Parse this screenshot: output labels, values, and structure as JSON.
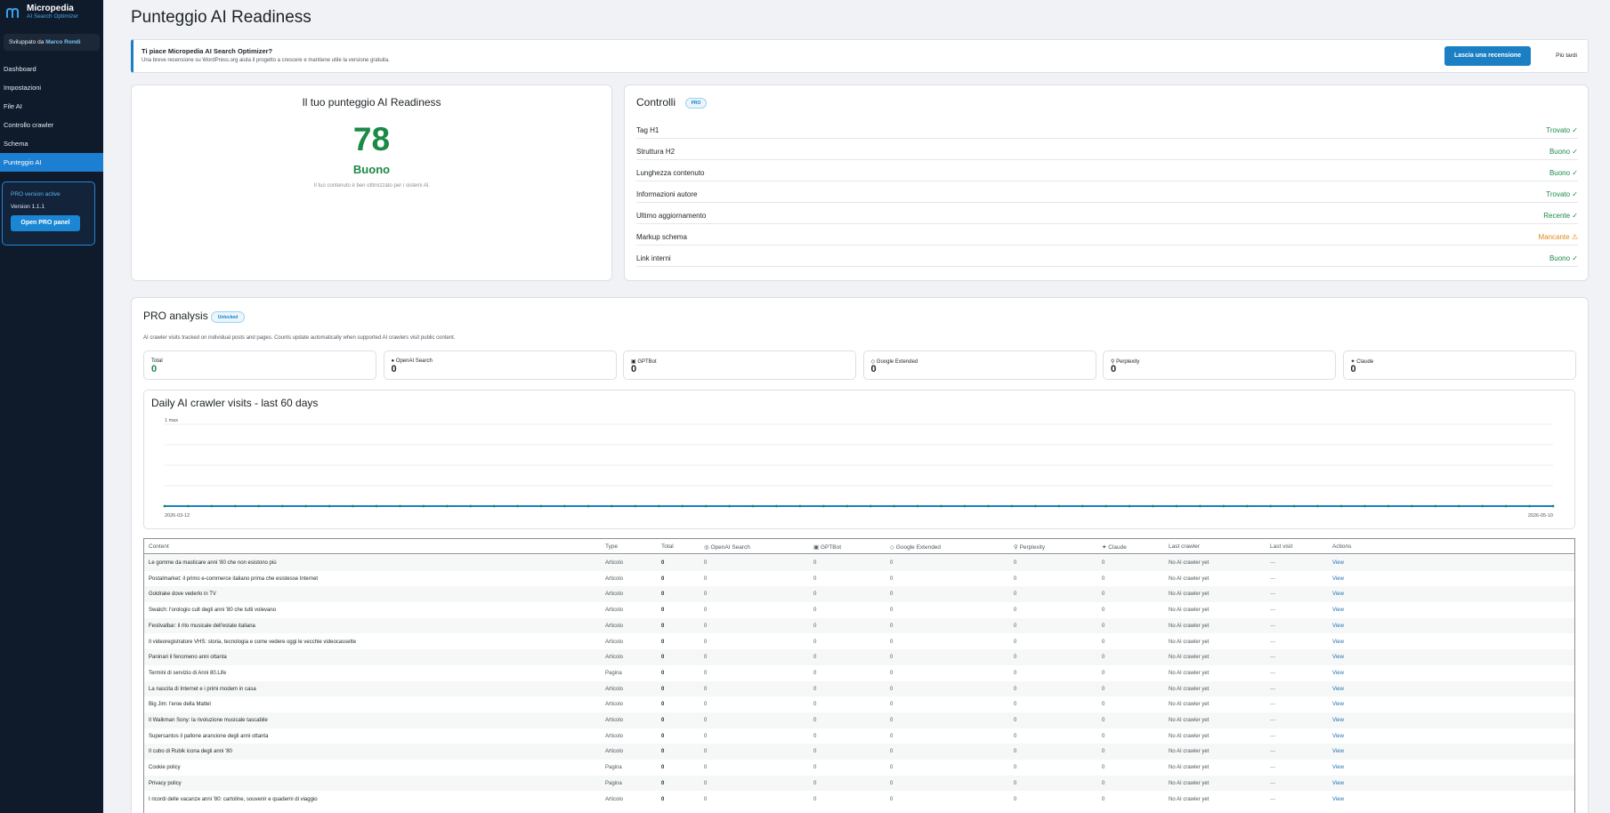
{
  "sidebar": {
    "brand_title": "Micropedia",
    "brand_subtitle": "AI Search Optimizer",
    "developer_prefix": "Sviluppato da",
    "developer_name": "Marco Rondi",
    "items": [
      {
        "label": "Dashboard",
        "active": false
      },
      {
        "label": "Impostazioni",
        "active": false
      },
      {
        "label": "File AI",
        "active": false
      },
      {
        "label": "Controllo crawler",
        "active": false
      },
      {
        "label": "Schema",
        "active": false
      },
      {
        "label": "Punteggio AI",
        "active": true
      }
    ],
    "pro_card": {
      "status": "PRO version active",
      "version": "Version 1.1.1",
      "button": "Open PRO panel"
    }
  },
  "page_title": "Punteggio AI Readiness",
  "banner": {
    "title": "Ti piace Micropedia AI Search Optimizer?",
    "subtitle": "Una breve recensione su WordPress.org aiuta il progetto a crescere e mantiene utile la versione gratuita.",
    "primary_button": "Lascia una recensione",
    "later_link": "Più tardi"
  },
  "score": {
    "title": "Il tuo punteggio AI Readiness",
    "value": "78",
    "label": "Buono",
    "description": "Il tuo contenuto è ben ottimizzato per i sistemi AI."
  },
  "checks": {
    "title": "Controlli",
    "badge": "PRO",
    "items": [
      {
        "label": "Tag H1",
        "value": "Trovato ✓",
        "status": "ok"
      },
      {
        "label": "Struttura H2",
        "value": "Buono ✓",
        "status": "ok"
      },
      {
        "label": "Lunghezza contenuto",
        "value": "Buono ✓",
        "status": "ok"
      },
      {
        "label": "Informazioni autore",
        "value": "Trovato ✓",
        "status": "ok"
      },
      {
        "label": "Ultimo aggiornamento",
        "value": "Recente ✓",
        "status": "ok"
      },
      {
        "label": "Markup schema",
        "value": "Mancante ⚠",
        "status": "warn"
      },
      {
        "label": "Link interni",
        "value": "Buono ✓",
        "status": "ok"
      }
    ]
  },
  "pro_analysis": {
    "title": "PRO analysis",
    "badge": "Unlocked",
    "description": "AI crawler visits tracked on individual posts and pages. Counts update automatically when supported AI crawlers visit public content.",
    "stats": [
      {
        "label": "Total",
        "value": "0",
        "icon": "",
        "color": "#1a8a46"
      },
      {
        "label": "OpenAI Search",
        "value": "0",
        "icon": "●",
        "color": "#1d2327"
      },
      {
        "label": "GPTBot",
        "value": "0",
        "icon": "▣",
        "color": "#1d2327"
      },
      {
        "label": "Google Extended",
        "value": "0",
        "icon": "◇",
        "color": "#1d2327"
      },
      {
        "label": "Perplexity",
        "value": "0",
        "icon": "⚲",
        "color": "#1d2327"
      },
      {
        "label": "Claude",
        "value": "0",
        "icon": "✦",
        "color": "#1d2327"
      }
    ]
  },
  "chart_data": {
    "type": "line",
    "title": "Daily AI crawler visits - last 60 days",
    "y_tick_label": "1 max",
    "x_start_label": "2026-03-12",
    "x_end_label": "2026-05-10",
    "ylim": [
      0,
      1
    ],
    "points": 60,
    "values": [
      0,
      0,
      0,
      0,
      0,
      0,
      0,
      0,
      0,
      0,
      0,
      0,
      0,
      0,
      0,
      0,
      0,
      0,
      0,
      0,
      0,
      0,
      0,
      0,
      0,
      0,
      0,
      0,
      0,
      0,
      0,
      0,
      0,
      0,
      0,
      0,
      0,
      0,
      0,
      0,
      0,
      0,
      0,
      0,
      0,
      0,
      0,
      0,
      0,
      0,
      0,
      0,
      0,
      0,
      0,
      0,
      0,
      0,
      0,
      0
    ],
    "color": "#1c7fc4",
    "grid": true
  },
  "table": {
    "columns": [
      "Content",
      "Type",
      "Total",
      "◎ OpenAI Search",
      "▣ GPTBot",
      "◇ Google Extended",
      "⚲ Perplexity",
      "✦ Claude",
      "Last crawler",
      "Last visit",
      "Actions"
    ],
    "rows": [
      {
        "content": "Le gomme da masticare anni '80 che non esistono più",
        "type": "Articolo"
      },
      {
        "content": "Postalmarket: il primo e-commerce italiano prima che esistesse Internet",
        "type": "Articolo"
      },
      {
        "content": "Goldrake dove vederlo in TV",
        "type": "Articolo"
      },
      {
        "content": "Swatch: l'orologio cult degli anni '80 che tutti volevano",
        "type": "Articolo"
      },
      {
        "content": "Festivalbar: il rito musicale dell'estate italiana",
        "type": "Articolo"
      },
      {
        "content": "Il videoregistratore VHS: storia, tecnologia e come vedere oggi le vecchie videocassette",
        "type": "Articolo"
      },
      {
        "content": "Paninari il fenomeno anni ottanta",
        "type": "Articolo"
      },
      {
        "content": "Termini di servizio di Anni 80.Life",
        "type": "Pagina"
      },
      {
        "content": "La nascita di Internet e i primi modem in casa",
        "type": "Articolo"
      },
      {
        "content": "Big Jim: l'eroe della Mattel",
        "type": "Articolo"
      },
      {
        "content": "Il Walkman Sony: la rivoluzione musicale tascabile",
        "type": "Articolo"
      },
      {
        "content": "Supersantos il pallone arancione degli anni ottanta",
        "type": "Articolo"
      },
      {
        "content": "Il cubo di Rubik icona degli anni '80",
        "type": "Articolo"
      },
      {
        "content": "Cookie policy",
        "type": "Pagina"
      },
      {
        "content": "Privacy policy",
        "type": "Pagina"
      },
      {
        "content": "I ricordi delle vacanze anni '80: cartoline, souvenir e quaderni di viaggio",
        "type": "Articolo"
      }
    ],
    "zero": "0",
    "last_crawler": "No AI crawler yet",
    "last_visit": "—",
    "action": "View"
  }
}
